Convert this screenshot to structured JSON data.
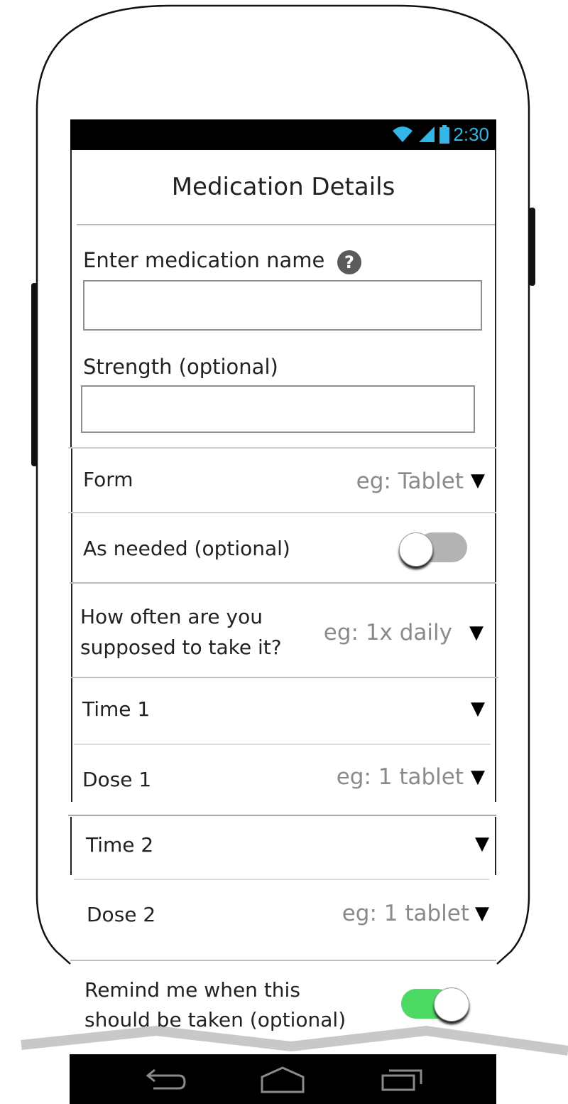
{
  "colors": {
    "accent": "#33b5e5",
    "toggle_on": "#4cd964",
    "toggle_off": "#b3b3b3"
  },
  "status_bar": {
    "time": "2:30",
    "icons": [
      "wifi-icon",
      "cell-signal-icon",
      "battery-icon"
    ]
  },
  "header": {
    "title": "Medication Details"
  },
  "form": {
    "name_label": "Enter medication name",
    "name_help_glyph": "?",
    "name_value": "",
    "strength_label": "Strength (optional)",
    "strength_value": "",
    "form_label": "Form",
    "form_placeholder": "eg: Tablet",
    "as_needed_label": "As needed (optional)",
    "as_needed_on": false,
    "how_often_line1": "How often are you",
    "how_often_line2": "supposed to take it?",
    "how_often_placeholder": "eg: 1x daily",
    "time1_label": "Time 1",
    "dose1_label": "Dose 1",
    "dose1_placeholder": "eg: 1 tablet",
    "time2_label": "Time 2",
    "dose2_label": "Dose 2",
    "dose2_placeholder": "eg: 1 tablet",
    "remind_line1": "Remind me when this",
    "remind_line2": "should be taken (optional)",
    "remind_on": true,
    "dropdown_glyph": "▼"
  },
  "nav_bar": {
    "icons": [
      "back-icon",
      "home-icon",
      "recent-apps-icon"
    ]
  }
}
